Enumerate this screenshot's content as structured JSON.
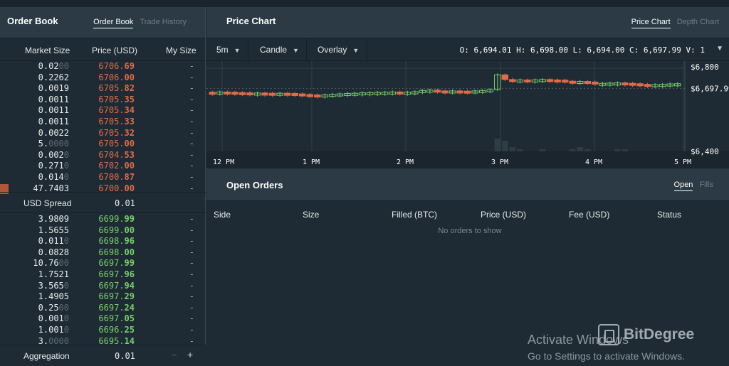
{
  "order_book": {
    "title": "Order Book",
    "tabs": [
      "Order Book",
      "Trade History"
    ],
    "columns": [
      "Market Size",
      "Price (USD)",
      "My Size"
    ],
    "asks": [
      {
        "size_hi": "0.02",
        "size_lo": "00",
        "price_hi": "6706.",
        "price_lo": "69",
        "mine": "-"
      },
      {
        "size_hi": "0.2262",
        "size_lo": "",
        "price_hi": "6706.",
        "price_lo": "00",
        "mine": "-"
      },
      {
        "size_hi": "0.0019",
        "size_lo": "",
        "price_hi": "6705.",
        "price_lo": "82",
        "mine": "-"
      },
      {
        "size_hi": "0.0011",
        "size_lo": "",
        "price_hi": "6705.",
        "price_lo": "35",
        "mine": "-"
      },
      {
        "size_hi": "0.0011",
        "size_lo": "",
        "price_hi": "6705.",
        "price_lo": "34",
        "mine": "-"
      },
      {
        "size_hi": "0.0011",
        "size_lo": "",
        "price_hi": "6705.",
        "price_lo": "33",
        "mine": "-"
      },
      {
        "size_hi": "0.0022",
        "size_lo": "",
        "price_hi": "6705.",
        "price_lo": "32",
        "mine": "-"
      },
      {
        "size_hi": "5.",
        "size_lo": "0000",
        "price_hi": "6705.",
        "price_lo": "00",
        "mine": "-"
      },
      {
        "size_hi": "0.002",
        "size_lo": "0",
        "price_hi": "6704.",
        "price_lo": "53",
        "mine": "-"
      },
      {
        "size_hi": "0.271",
        "size_lo": "0",
        "price_hi": "6702.",
        "price_lo": "00",
        "mine": "-"
      },
      {
        "size_hi": "0.014",
        "size_lo": "0",
        "price_hi": "6700.",
        "price_lo": "87",
        "mine": "-"
      },
      {
        "size_hi": "47.7403",
        "size_lo": "",
        "price_hi": "6700.",
        "price_lo": "00",
        "mine": "-"
      }
    ],
    "spread_label": "USD Spread",
    "spread_value": "0.01",
    "bids": [
      {
        "size_hi": "3.9809",
        "size_lo": "",
        "price_hi": "6699.",
        "price_lo": "99",
        "mine": "-"
      },
      {
        "size_hi": "1.5655",
        "size_lo": "",
        "price_hi": "6699.",
        "price_lo": "00",
        "mine": "-"
      },
      {
        "size_hi": "0.011",
        "size_lo": "0",
        "price_hi": "6698.",
        "price_lo": "96",
        "mine": "-"
      },
      {
        "size_hi": "0.0828",
        "size_lo": "",
        "price_hi": "6698.",
        "price_lo": "00",
        "mine": "-"
      },
      {
        "size_hi": "10.76",
        "size_lo": "00",
        "price_hi": "6697.",
        "price_lo": "99",
        "mine": "-"
      },
      {
        "size_hi": "1.7521",
        "size_lo": "",
        "price_hi": "6697.",
        "price_lo": "96",
        "mine": "-"
      },
      {
        "size_hi": "3.565",
        "size_lo": "0",
        "price_hi": "6697.",
        "price_lo": "94",
        "mine": "-"
      },
      {
        "size_hi": "1.4905",
        "size_lo": "",
        "price_hi": "6697.",
        "price_lo": "29",
        "mine": "-"
      },
      {
        "size_hi": "0.25",
        "size_lo": "00",
        "price_hi": "6697.",
        "price_lo": "24",
        "mine": "-"
      },
      {
        "size_hi": "0.001",
        "size_lo": "0",
        "price_hi": "6697.",
        "price_lo": "05",
        "mine": "-"
      },
      {
        "size_hi": "1.001",
        "size_lo": "0",
        "price_hi": "6696.",
        "price_lo": "25",
        "mine": "-"
      },
      {
        "size_hi": "3.",
        "size_lo": "0000",
        "price_hi": "6695.",
        "price_lo": "14",
        "mine": "-"
      }
    ],
    "aggregation_label": "Aggregation",
    "aggregation_value": "0.01",
    "minus": "−",
    "plus": "+",
    "colors": {
      "ask": "#e06b48",
      "bid": "#78d069"
    }
  },
  "price_chart": {
    "title": "Price Chart",
    "tabs": [
      "Price Chart",
      "Depth Chart"
    ],
    "interval": "5m",
    "chart_type": "Candle",
    "overlay": "Overlay",
    "ohlc": "O: 6,694.01 H: 6,698.00 L: 6,694.00 C: 6,697.99 V: 1",
    "icons": {
      "dropdown": "chevron-down-icon"
    }
  },
  "chart_data": {
    "type": "candlestick",
    "x_labels": [
      "12 PM",
      "1 PM",
      "2 PM",
      "3 PM",
      "4 PM",
      "5 PM"
    ],
    "y_labels": [
      "$6,800",
      "$6,697.99",
      "$6,400"
    ],
    "ylim": [
      6400,
      6800
    ],
    "last_price": 6697.99,
    "up_color": "#78d069",
    "down_color": "#e06b48",
    "candles": [
      {
        "o": 6680,
        "c": 6679
      },
      {
        "o": 6680,
        "c": 6681
      },
      {
        "o": 6681,
        "c": 6680
      },
      {
        "o": 6680,
        "c": 6678
      },
      {
        "o": 6678,
        "c": 6676
      },
      {
        "o": 6677,
        "c": 6675
      },
      {
        "o": 6675,
        "c": 6676
      },
      {
        "o": 6676,
        "c": 6675
      },
      {
        "o": 6675,
        "c": 6673
      },
      {
        "o": 6674,
        "c": 6675
      },
      {
        "o": 6675,
        "c": 6674
      },
      {
        "o": 6674,
        "c": 6672
      },
      {
        "o": 6672,
        "c": 6669
      },
      {
        "o": 6669,
        "c": 6667
      },
      {
        "o": 6667,
        "c": 6665
      },
      {
        "o": 6665,
        "c": 6667
      },
      {
        "o": 6667,
        "c": 6670
      },
      {
        "o": 6669,
        "c": 6672
      },
      {
        "o": 6671,
        "c": 6674
      },
      {
        "o": 6674,
        "c": 6675
      },
      {
        "o": 6675,
        "c": 6677
      },
      {
        "o": 6677,
        "c": 6678
      },
      {
        "o": 6678,
        "c": 6679
      },
      {
        "o": 6679,
        "c": 6680
      },
      {
        "o": 6680,
        "c": 6681
      },
      {
        "o": 6681,
        "c": 6679
      },
      {
        "o": 6679,
        "c": 6680
      },
      {
        "o": 6680,
        "c": 6682
      },
      {
        "o": 6682,
        "c": 6688
      },
      {
        "o": 6688,
        "c": 6690
      },
      {
        "o": 6690,
        "c": 6686
      },
      {
        "o": 6686,
        "c": 6682
      },
      {
        "o": 6682,
        "c": 6686
      },
      {
        "o": 6686,
        "c": 6685
      },
      {
        "o": 6685,
        "c": 6684
      },
      {
        "o": 6684,
        "c": 6686
      },
      {
        "o": 6686,
        "c": 6688
      },
      {
        "o": 6688,
        "c": 6692
      },
      {
        "o": 6692,
        "c": 6762
      },
      {
        "o": 6762,
        "c": 6740
      },
      {
        "o": 6740,
        "c": 6735
      },
      {
        "o": 6735,
        "c": 6738
      },
      {
        "o": 6738,
        "c": 6735
      },
      {
        "o": 6735,
        "c": 6738
      },
      {
        "o": 6738,
        "c": 6740
      },
      {
        "o": 6740,
        "c": 6738
      },
      {
        "o": 6738,
        "c": 6737
      },
      {
        "o": 6737,
        "c": 6732
      },
      {
        "o": 6732,
        "c": 6730
      },
      {
        "o": 6730,
        "c": 6731
      },
      {
        "o": 6731,
        "c": 6728
      },
      {
        "o": 6728,
        "c": 6720
      },
      {
        "o": 6720,
        "c": 6722
      },
      {
        "o": 6722,
        "c": 6723
      },
      {
        "o": 6723,
        "c": 6724
      },
      {
        "o": 6724,
        "c": 6722
      },
      {
        "o": 6722,
        "c": 6720
      },
      {
        "o": 6720,
        "c": 6717
      },
      {
        "o": 6717,
        "c": 6715
      },
      {
        "o": 6715,
        "c": 6716
      },
      {
        "o": 6716,
        "c": 6717
      },
      {
        "o": 6717,
        "c": 6719
      },
      {
        "o": 6719,
        "c": 6720
      }
    ],
    "volumes": [
      0,
      0,
      0,
      0,
      0,
      0,
      0,
      0,
      0,
      0,
      0,
      0,
      0,
      0,
      0,
      0,
      0,
      0,
      0,
      0,
      0,
      0,
      0,
      0,
      0,
      0,
      0,
      0,
      0,
      0,
      0,
      0,
      0,
      0,
      0,
      0,
      0,
      0,
      6,
      5,
      2,
      1,
      0,
      0,
      1,
      0,
      0,
      0,
      1,
      2,
      1,
      0,
      0,
      0,
      1,
      1,
      0,
      0,
      0,
      0,
      0,
      0,
      0
    ]
  },
  "open_orders": {
    "title": "Open Orders",
    "tabs": [
      "Open",
      "Fills"
    ],
    "columns": [
      "Side",
      "Size",
      "Filled (BTC)",
      "Price (USD)",
      "Fee (USD)",
      "Status"
    ],
    "empty_message": "No orders to show"
  },
  "watermark": {
    "line1": "Activate Windows",
    "line2": "Go to Settings to activate Windows.",
    "brand": "BitDegree"
  }
}
